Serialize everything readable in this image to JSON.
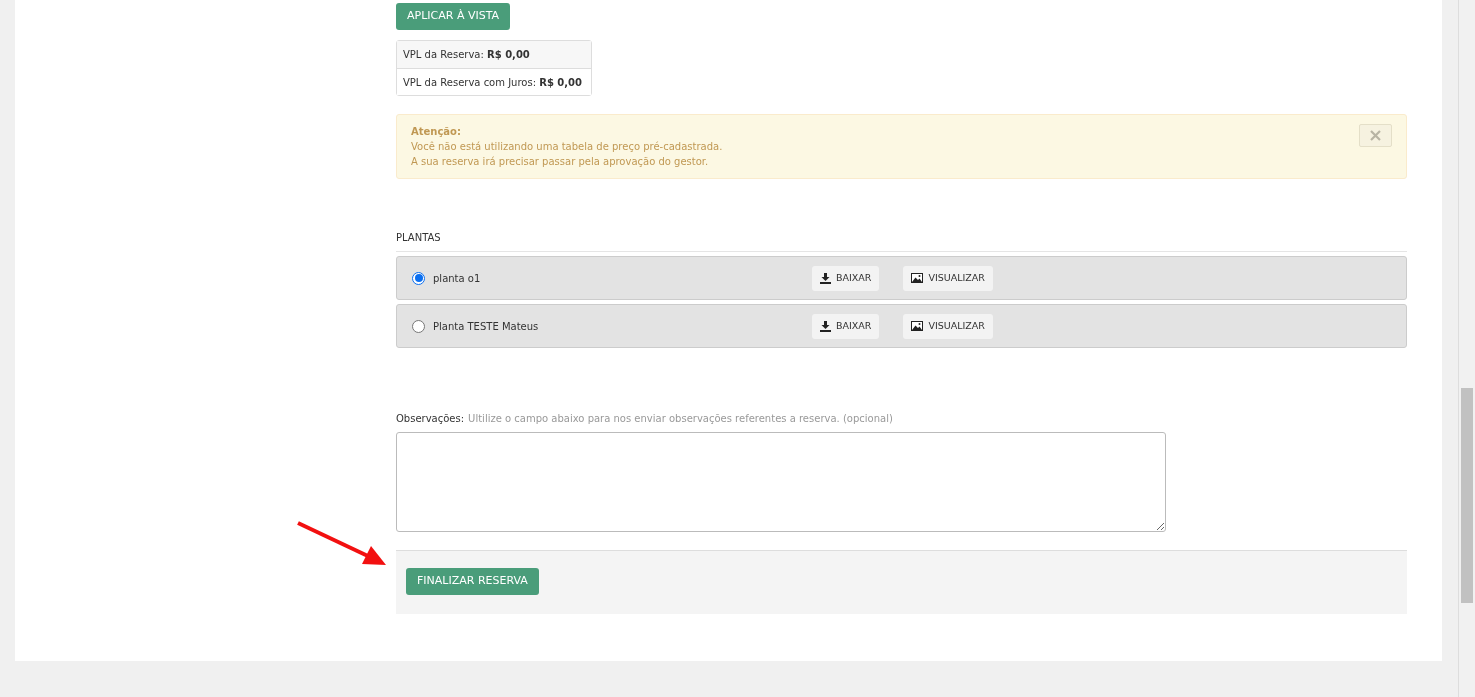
{
  "apply_button": "APLICAR À VISTA",
  "summary": [
    {
      "label": "VPL da Reserva:",
      "value": "R$ 0,00"
    },
    {
      "label": "VPL da Reserva com Juros:",
      "value": "R$ 0,00"
    }
  ],
  "alert": {
    "title": "Atenção:",
    "lines": [
      "Você não está utilizando uma tabela de preço pré-cadastrada.",
      "A sua reserva irá precisar passar pela aprovação do gestor."
    ]
  },
  "plans": {
    "title": "PLANTAS",
    "items": [
      {
        "name": "planta o1",
        "selected": true,
        "download": "BAIXAR",
        "view": "VISUALIZAR"
      },
      {
        "name": "Planta TESTE Mateus",
        "selected": false,
        "download": "BAIXAR",
        "view": "VISUALIZAR"
      }
    ]
  },
  "notes": {
    "label": "Observações:",
    "hint": "Ultilize o campo abaixo para nos enviar observações referentes a reserva. (opcional)"
  },
  "submit_button": "FINALIZAR RESERVA"
}
